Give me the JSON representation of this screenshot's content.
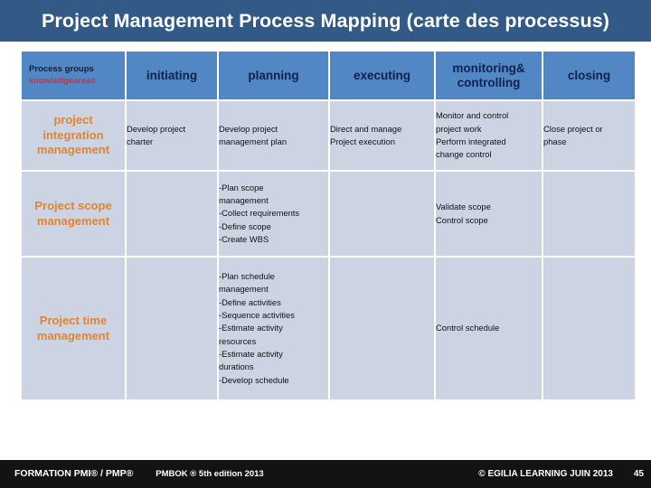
{
  "slide": {
    "title": "Project Management Process Mapping  (carte des processus)",
    "title_bar_color": "#335a87",
    "header_cell_color": "#5087c4",
    "body_cell_color": "#ccd4e4",
    "area_label_color": "#e18430",
    "accent_red": "#e8262d"
  },
  "table": {
    "corner": {
      "line1": "Process groups",
      "line2": "knowledgeareas"
    },
    "columns": [
      "initiating",
      "planning",
      "executing",
      "monitoring& controlling",
      "closing"
    ],
    "columns_multiline": {
      "monitoring_line1": "monitoring&",
      "monitoring_line2": "controlling"
    },
    "rows": [
      {
        "area": "project integration management",
        "area_lines": [
          "project",
          "integration",
          "management"
        ],
        "initiating": [
          "Develop project",
          "charter"
        ],
        "planning": [
          "Develop project",
          "management plan"
        ],
        "executing": [
          "Direct and manage",
          "Project execution"
        ],
        "monitoring": [
          "Monitor and control",
          "project work",
          "Perform integrated",
          "change control"
        ],
        "closing": [
          "Close project or",
          "phase"
        ]
      },
      {
        "area": "Project scope management",
        "area_lines": [
          "Project scope",
          "management"
        ],
        "initiating": [],
        "planning": [
          "-Plan scope",
          "management",
          "-Collect requirements",
          "-Define scope",
          "-Create WBS"
        ],
        "executing": [],
        "monitoring": [
          "Validate scope",
          "Control scope"
        ],
        "closing": []
      },
      {
        "area": "Project time management",
        "area_lines": [
          "Project time",
          "management"
        ],
        "initiating": [],
        "planning": [
          "-Plan schedule",
          "management",
          "-Define activities",
          "-Sequence activities",
          "-Estimate activity",
          "resources",
          "-Estimate activity",
          "durations",
          "-Develop schedule"
        ],
        "executing": [],
        "monitoring": [
          "Control schedule"
        ],
        "closing": []
      }
    ]
  },
  "footer": {
    "formation": "FORMATION PMI® / PMP®",
    "pmbok": "PMBOK ® 5th edition  2013",
    "copyright": "© EGILIA LEARNING  JUIN 2013",
    "page_number": "45"
  }
}
